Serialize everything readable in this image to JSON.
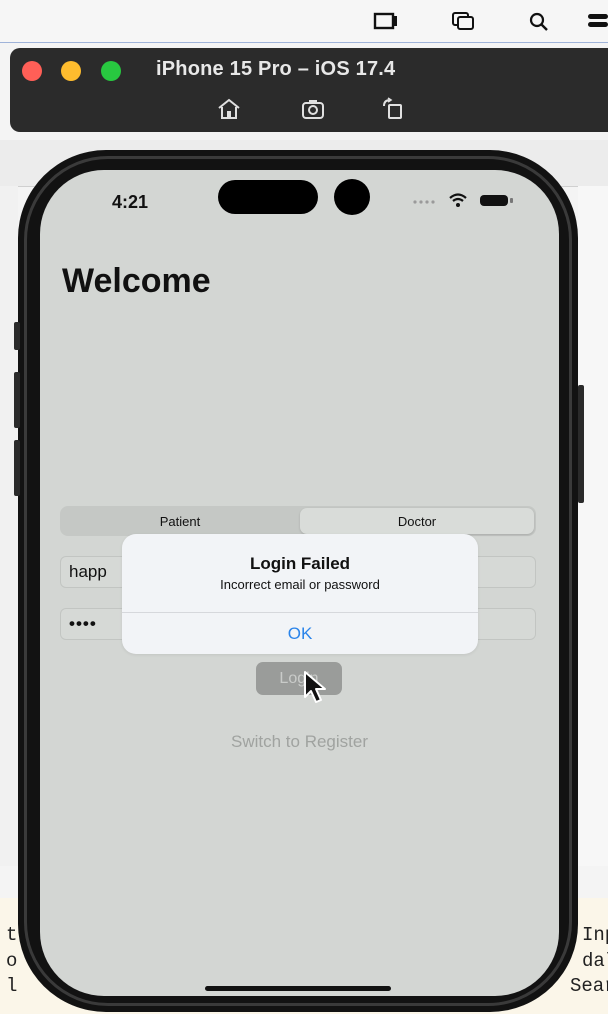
{
  "simulator": {
    "title": "iPhone 15 Pro – iOS 17.4",
    "controls": [
      "home-icon",
      "screenshot-icon",
      "rotate-icon"
    ]
  },
  "status_bar": {
    "time": "4:21"
  },
  "screen": {
    "heading": "Welcome",
    "segments": {
      "patient": "Patient",
      "doctor": "Doctor",
      "selected": "Doctor"
    },
    "email_value": "happ",
    "password_mask": "••••",
    "login_label": "Login",
    "switch_label": "Switch to Register"
  },
  "alert": {
    "title": "Login Failed",
    "message": "Incorrect email or password",
    "ok_label": "OK"
  },
  "background_editor": {
    "right_lines": [
      "Inp",
      "dal",
      "Sear"
    ],
    "left_lines": [
      "t",
      "o",
      "l"
    ]
  },
  "colors": {
    "alert_ok": "#2b84ea",
    "close": "#ff5f57",
    "minimize": "#febc2e",
    "zoom": "#28c840"
  }
}
